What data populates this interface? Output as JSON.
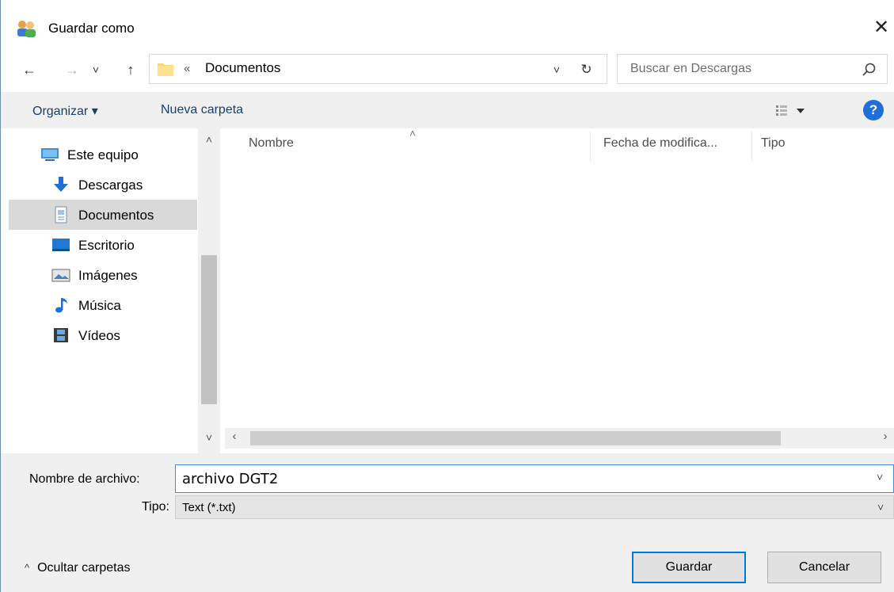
{
  "window": {
    "title": "Guardar como",
    "close_glyph": "✕"
  },
  "navigation": {
    "back_glyph": "←",
    "forward_glyph": "→",
    "recent_glyph": "˅",
    "up_glyph": "↑"
  },
  "address": {
    "overflow_glyph": "«",
    "current_folder": "Documentos",
    "dropdown_glyph": "˅",
    "refresh_glyph": "↻"
  },
  "search": {
    "placeholder": "Buscar en Descargas"
  },
  "toolbar": {
    "organize_label": "Organizar ▾",
    "new_folder_label": "Nueva carpeta",
    "help_label": "?"
  },
  "sidebar": {
    "scroll_up": "˄",
    "scroll_down": "˅",
    "items": [
      {
        "label": "Este equipo",
        "icon": "computer-icon"
      },
      {
        "label": "Descargas",
        "icon": "download-arrow-icon"
      },
      {
        "label": "Documentos",
        "icon": "document-icon",
        "selected": true
      },
      {
        "label": "Escritorio",
        "icon": "desktop-icon"
      },
      {
        "label": "Imágenes",
        "icon": "pictures-icon"
      },
      {
        "label": "Música",
        "icon": "music-note-icon"
      },
      {
        "label": "Vídeos",
        "icon": "film-icon"
      }
    ]
  },
  "file_list": {
    "sort_glyph": "˄",
    "columns": [
      "Nombre",
      "Fecha de modifica...",
      "Tipo"
    ],
    "scroll_left": "‹",
    "scroll_right": "›"
  },
  "form": {
    "filename_label": "Nombre de archivo:",
    "filename_value": "archivo DGT2",
    "filename_dropdown": "˅",
    "type_label": "Tipo:",
    "type_value": "Text (*.txt)",
    "type_dropdown": "˅"
  },
  "footer": {
    "hide_folders_caret": "^",
    "hide_folders_label": "Ocultar carpetas",
    "save_label": "Guardar",
    "cancel_label": "Cancelar"
  },
  "colors": {
    "accent": "#0078d7",
    "help": "#1f6fd6",
    "folder": "#f8d775"
  }
}
